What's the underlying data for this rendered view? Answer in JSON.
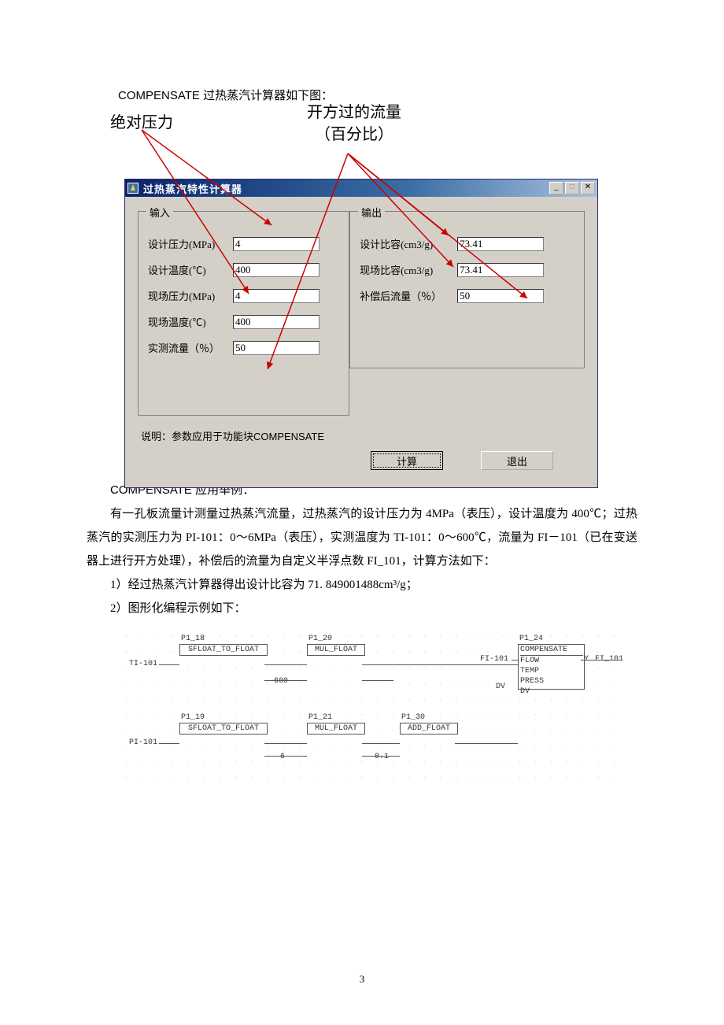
{
  "intro_text": "COMPENSATE 过热蒸汽计算器如下图：",
  "annotations": {
    "left": "绝对压力",
    "right_line1": "开方过的流量",
    "right_line2": "（百分比）"
  },
  "window": {
    "title": "过热蒸汽特性计算器",
    "group_in_legend": "输入",
    "group_out_legend": "输出",
    "inputs": {
      "design_pressure_label": "设计压力(MPa)",
      "design_pressure_value": "4",
      "design_temp_label": "设计温度(℃)",
      "design_temp_value": "400",
      "field_pressure_label": "现场压力(MPa)",
      "field_pressure_value": "4",
      "field_temp_label": "现场温度(℃)",
      "field_temp_value": "400",
      "measured_flow_label": "实测流量（％）",
      "measured_flow_value": "50"
    },
    "outputs": {
      "design_sv_label": "设计比容(cm3/g)",
      "design_sv_value": "73.41",
      "field_sv_label": "现场比容(cm3/g)",
      "field_sv_value": "73.41",
      "comp_flow_label": "补偿后流量（％）",
      "comp_flow_value": "50"
    },
    "note": "说明：参数应用于功能块COMPENSATE",
    "btn_calc": "计算",
    "btn_exit": "退出"
  },
  "body": {
    "ex_heading": "COMPENSATE 应用举例：",
    "p1": "有一孔板流量计测量过热蒸汽流量，过热蒸汽的设计压力为 4MPa（表压），设计温度为 400℃；过热蒸汽的实测压力为 PI-101：0～6MPa（表压），实测温度为 TI-101：0～600℃，流量为 FI－101（已在变送器上进行开方处理），补偿后的流量为自定义半浮点数 FI_101，计算方法如下：",
    "step1": "1）经过热蒸汽计算器得出设计比容为 71. 849001488cm³/g；",
    "step2": "2）图形化编程示例如下："
  },
  "flow": {
    "blocks": {
      "p1_18": "P1_18",
      "sf1": "SFLOAT_TO_FLOAT",
      "p1_20": "P1_20",
      "mul1": "MUL_FLOAT",
      "p1_24": "P1_24",
      "comp": "COMPENSATE",
      "p1_19": "P1_19",
      "sf2": "SFLOAT_TO_FLOAT",
      "p1_21": "P1_21",
      "mul2": "MUL_FLOAT",
      "p1_30": "P1_30",
      "add": "ADD_FLOAT"
    },
    "labels": {
      "ti101": "TI-101",
      "pi101": "PI-101",
      "c600": "600",
      "c6": "6",
      "c01": "0.1",
      "fi101in": "FI-101",
      "flow": "FLOW",
      "temp": "TEMP",
      "press": "PRESS",
      "dv1": "DV",
      "dv2": "DV",
      "y": "Y",
      "fi101out": "FI_101"
    }
  },
  "page_number": "3"
}
